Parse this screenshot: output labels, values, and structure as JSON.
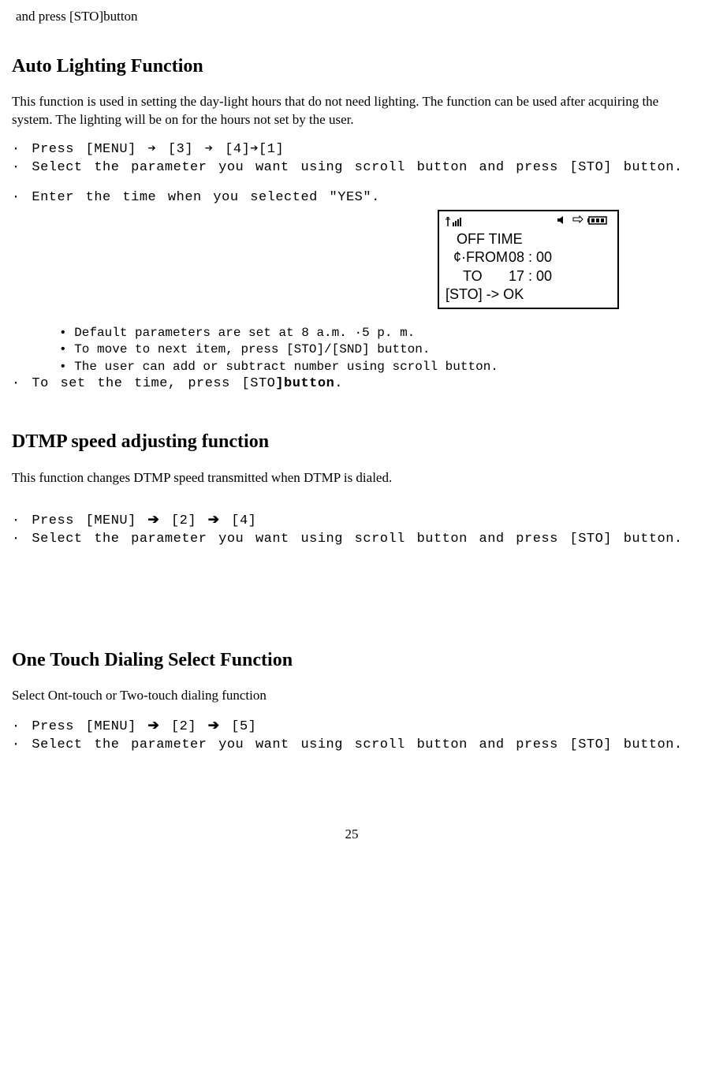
{
  "top_fragment": "and press [STO]button",
  "auto_lighting": {
    "heading": "Auto Lighting Function",
    "intro": "This function is used in setting the day-light hours that do not need lighting. The function can be used after acquiring the system. The lighting will be on for the hours not set by the user.",
    "step1": "· Press [MENU] ➔ [3] ➔ [4]➔[1]",
    "step2": "·  Select  the  parameter  you  want  using  scroll  button  and  press [STO] button.",
    "step3": "· Enter the time when you selected \"YES\".",
    "screen": {
      "title": "OFF TIME",
      "from_label": "¢·FROM",
      "from_val": "08 : 00",
      "to_label": "TO",
      "to_val": "17 : 00",
      "ok": "[STO] -> OK"
    },
    "note1": "• Default parameters are set at 8 a.m. ·5 p. m.",
    "note2": "•  To move to next item, press [STO]/[SND] button.",
    "note3": "• The user can add or subtract number using scroll button.",
    "step4_a": "· To set the time, press [STO",
    "step4_b": "]button",
    "step4_c": "."
  },
  "dtmp": {
    "heading": "DTMP speed adjusting function",
    "intro": "This function changes DTMP speed transmitted when DTMP is dialed.",
    "step1_a": "· Press [MENU]",
    "step1_mid": "[2]",
    "step1_end": "[4]",
    "step2": "·  Select  the  parameter  you  want  using  scroll  button  and  press [STO] button."
  },
  "one_touch": {
    "heading": "One Touch Dialing Select Function",
    "intro": "Select  Ont-touch or Two-touch  dialing function",
    "step1_a": "· Press [MENU]",
    "step1_mid": "[2]",
    "step1_end": "[5]",
    "step2": "·  Select  the  parameter  you  want  using  scroll  button  and  press [STO] button."
  },
  "page_number": "25"
}
